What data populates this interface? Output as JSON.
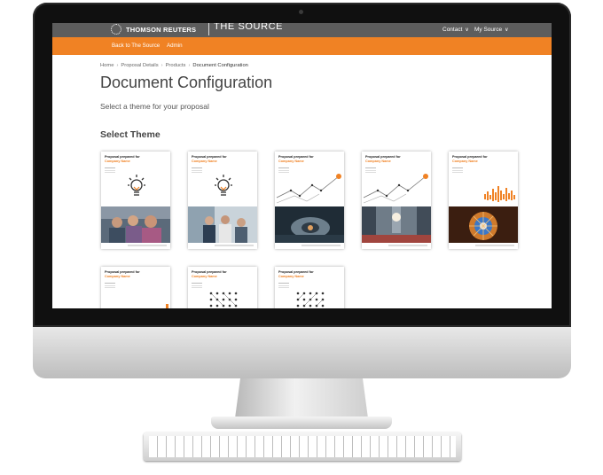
{
  "header": {
    "logo": "THOMSON REUTERS",
    "product": "THE SOURCE",
    "contact": "Contact",
    "my_source": "My Source"
  },
  "nav": {
    "back": "Back to The Source",
    "admin": "Admin"
  },
  "breadcrumb": [
    "Home",
    "Proposal Details",
    "Products",
    "Document Configuration"
  ],
  "page": {
    "title": "Document Configuration",
    "subtitle": "Select a theme for your proposal",
    "section": "Select Theme"
  },
  "theme_card": {
    "prepared_for": "Proposal prepared for",
    "company": "Company Name"
  },
  "themes": [
    {
      "art": "bulb-icon",
      "photo": "people-photo"
    },
    {
      "art": "bulb-icon",
      "photo": "meeting-photo"
    },
    {
      "art": "line-graph-icon",
      "photo": "machine-photo"
    },
    {
      "art": "line-graph-icon",
      "photo": "street-photo"
    },
    {
      "art": "waveform-icon",
      "photo": "dome-photo"
    },
    {
      "art": "blank",
      "photo": ""
    },
    {
      "art": "dot-grid-icon",
      "photo": ""
    },
    {
      "art": "dot-grid-icon",
      "photo": ""
    }
  ],
  "colors": {
    "accent": "#f08224",
    "topbar": "#5d5d5d"
  }
}
